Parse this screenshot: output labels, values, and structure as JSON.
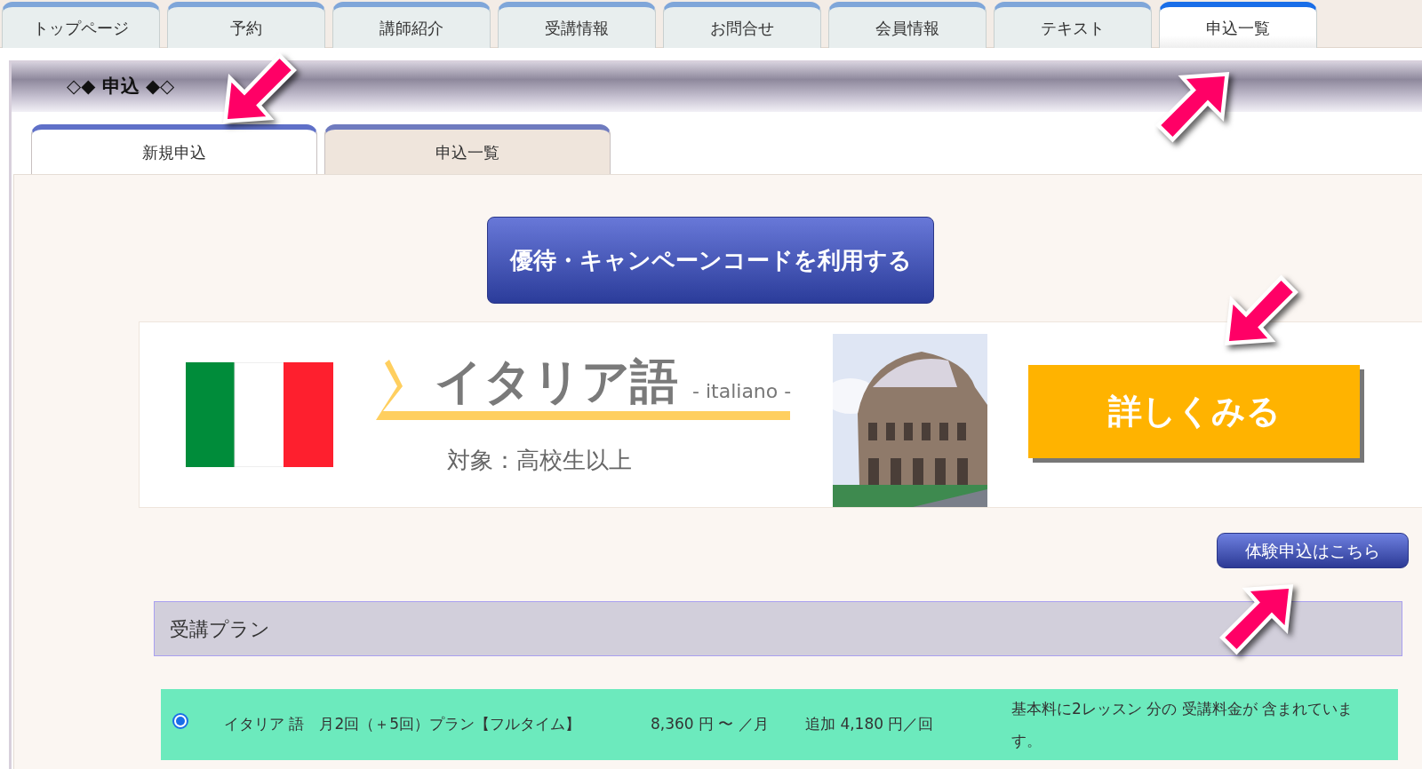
{
  "nav_tabs": [
    {
      "label": "トップページ",
      "selected": false
    },
    {
      "label": "予約",
      "selected": false
    },
    {
      "label": "講師紹介",
      "selected": false
    },
    {
      "label": "受講情報",
      "selected": false
    },
    {
      "label": "お問合せ",
      "selected": false
    },
    {
      "label": "会員情報",
      "selected": false
    },
    {
      "label": "テキスト",
      "selected": false
    },
    {
      "label": "申込一覧",
      "selected": true
    }
  ],
  "section_title": "◇◆ 申込 ◆◇",
  "sub_tabs": [
    {
      "label": "新規申込",
      "selected": true
    },
    {
      "label": "申込一覧",
      "selected": false
    }
  ],
  "campaign_button": "優待・キャンペーンコードを利用する",
  "course_banner": {
    "title": "イタリア語",
    "subtitle": "- italiano -",
    "target": "対象：高校生以上",
    "details_button": "詳しくみる"
  },
  "trial_button": "体験申込はこちら",
  "plans": {
    "heading": "受講プラン",
    "items": [
      {
        "name": "イタリア 語　月2回（＋5回）プラン【フルタイム】",
        "price": "8,360 円 〜 ／月",
        "extra": "追加 4,180 円／回",
        "note": "基本料に2レッスン 分の 受講料金が 含まれています。",
        "selected": true
      }
    ]
  },
  "callouts": [
    {
      "kind": "down-left"
    },
    {
      "kind": "up-right"
    },
    {
      "kind": "down-left"
    },
    {
      "kind": "up-right"
    }
  ]
}
